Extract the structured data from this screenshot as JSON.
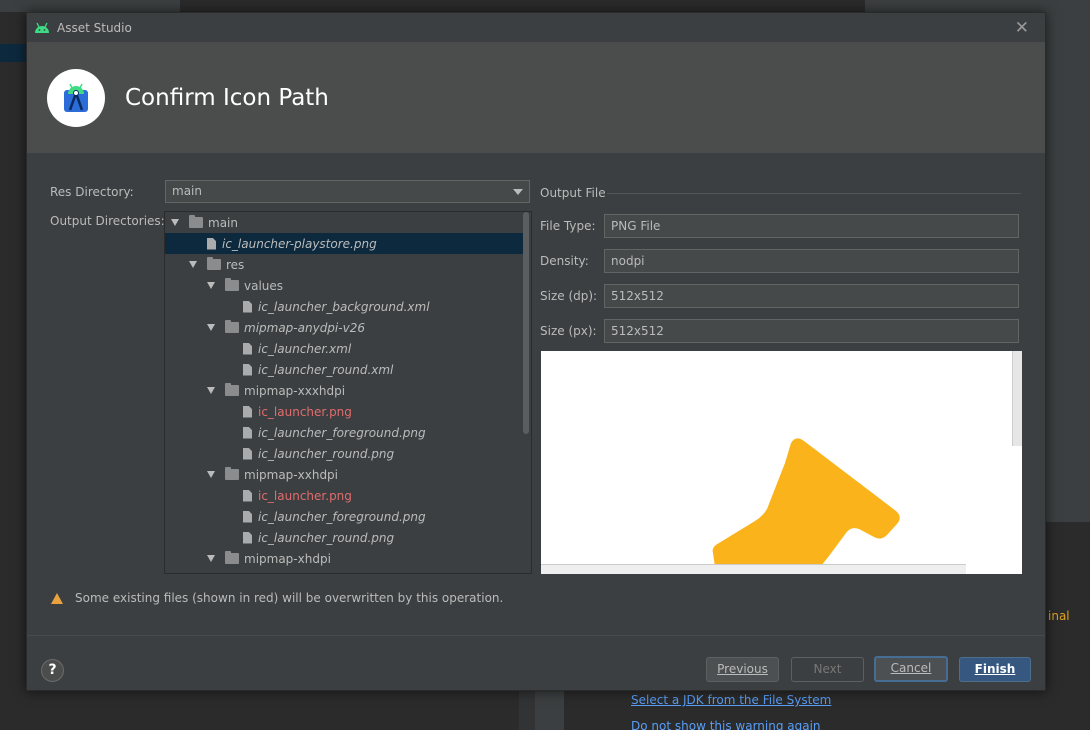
{
  "window": {
    "title": "Asset Studio",
    "close_glyph": "✕"
  },
  "header": {
    "heading": "Confirm Icon Path"
  },
  "form": {
    "res_directory_label": "Res Directory:",
    "res_directory_value": "main",
    "output_directories_label": "Output Directories:"
  },
  "tree": [
    {
      "label": "main",
      "type": "folder",
      "expanded": true,
      "depth": 0,
      "style": "normal"
    },
    {
      "label": "ic_launcher-playstore.png",
      "type": "file",
      "depth": 1,
      "style": "italic",
      "selected": true
    },
    {
      "label": "res",
      "type": "folder",
      "expanded": true,
      "depth": 1,
      "style": "normal"
    },
    {
      "label": "values",
      "type": "folder",
      "expanded": true,
      "depth": 2,
      "style": "normal"
    },
    {
      "label": "ic_launcher_background.xml",
      "type": "file",
      "depth": 3,
      "style": "italic"
    },
    {
      "label": "mipmap-anydpi-v26",
      "type": "folder",
      "expanded": true,
      "depth": 2,
      "style": "italic"
    },
    {
      "label": "ic_launcher.xml",
      "type": "file",
      "depth": 3,
      "style": "italic"
    },
    {
      "label": "ic_launcher_round.xml",
      "type": "file",
      "depth": 3,
      "style": "italic"
    },
    {
      "label": "mipmap-xxxhdpi",
      "type": "folder",
      "expanded": true,
      "depth": 2,
      "style": "normal"
    },
    {
      "label": "ic_launcher.png",
      "type": "file",
      "depth": 3,
      "style": "red"
    },
    {
      "label": "ic_launcher_foreground.png",
      "type": "file",
      "depth": 3,
      "style": "italic"
    },
    {
      "label": "ic_launcher_round.png",
      "type": "file",
      "depth": 3,
      "style": "italic"
    },
    {
      "label": "mipmap-xxhdpi",
      "type": "folder",
      "expanded": true,
      "depth": 2,
      "style": "normal"
    },
    {
      "label": "ic_launcher.png",
      "type": "file",
      "depth": 3,
      "style": "red"
    },
    {
      "label": "ic_launcher_foreground.png",
      "type": "file",
      "depth": 3,
      "style": "italic"
    },
    {
      "label": "ic_launcher_round.png",
      "type": "file",
      "depth": 3,
      "style": "italic"
    },
    {
      "label": "mipmap-xhdpi",
      "type": "folder",
      "expanded": true,
      "depth": 2,
      "style": "normal"
    }
  ],
  "output_file": {
    "section_title": "Output File",
    "file_type_label": "File Type:",
    "file_type_value": "PNG File",
    "density_label": "Density:",
    "density_value": "nodpi",
    "size_dp_label": "Size (dp):",
    "size_dp_value": "512x512",
    "size_px_label": "Size (px):",
    "size_px_value": "512x512"
  },
  "warning": {
    "text": "Some existing files (shown in red) will be overwritten by this operation."
  },
  "footer": {
    "help_label": "?",
    "previous_label": "Previous",
    "next_label": "Next",
    "cancel_label": "Cancel",
    "finish_label": "Finish"
  },
  "background": {
    "link1": "Select a JDK from the File System",
    "link2": "Do not show this warning again",
    "partial_text": "inal"
  },
  "colors": {
    "accent": "#365880",
    "warning": "#e8a33e",
    "overwrite_red": "#e06c6c",
    "icon_yellow": "#fbb31c"
  }
}
